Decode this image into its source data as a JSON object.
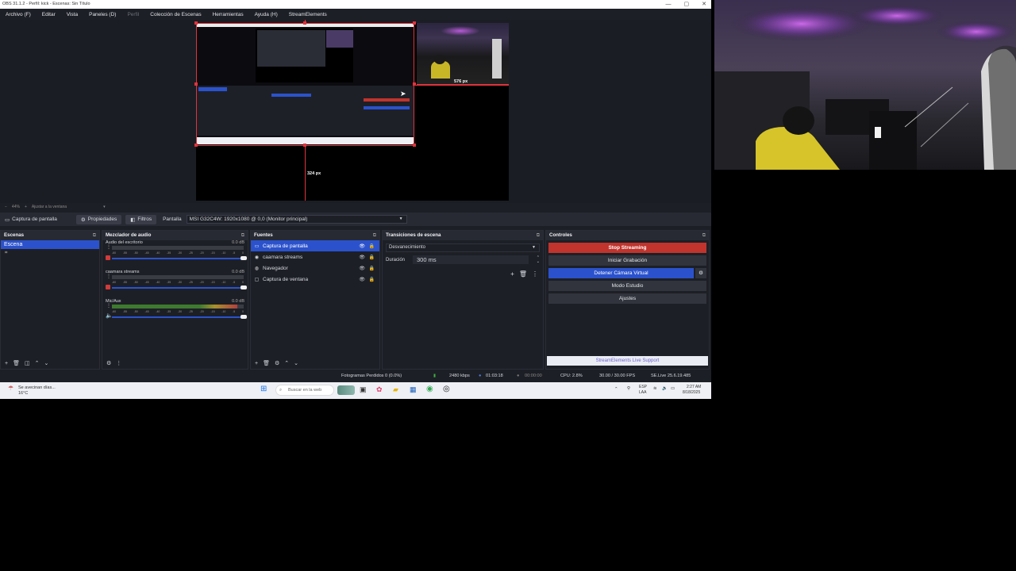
{
  "window": {
    "title": "OBS 31.1.2 - Perfil: kick - Escenas: Sin Título",
    "controls": [
      "—",
      "▢",
      "✕"
    ]
  },
  "menu": [
    {
      "label": "Archivo (F)",
      "disabled": false
    },
    {
      "label": "Editar",
      "disabled": false
    },
    {
      "label": "Vista",
      "disabled": false
    },
    {
      "label": "Paneles (D)",
      "disabled": false
    },
    {
      "label": "Perfil",
      "disabled": true
    },
    {
      "label": "Colección de Escenas",
      "disabled": false
    },
    {
      "label": "Herramientas",
      "disabled": false
    },
    {
      "label": "Ayuda (H)",
      "disabled": false
    },
    {
      "label": "StreamElements",
      "disabled": false
    }
  ],
  "preview": {
    "guide_right_label": "576 px",
    "guide_bottom_label": "324 px",
    "zoom_level": "44%",
    "zoom_mode": "Ajustar a la ventana"
  },
  "source_toolbar": {
    "source_name": "Captura de pantalla",
    "properties_label": "Propiedades",
    "filters_label": "Filtros",
    "screen_label": "Pantalla",
    "screen_value": "MSI G32C4W: 1920x1080 @ 0,0 (Monitor principal)"
  },
  "scenes": {
    "title": "Escenas",
    "items": [
      "Escena"
    ]
  },
  "mixer": {
    "title": "Mezclador de audio",
    "channels": [
      {
        "name": "Audio del escritorio",
        "db": "0.0 dB",
        "level": 0.0
      },
      {
        "name": "caamara streams",
        "db": "0.0 dB",
        "level": 0.0
      },
      {
        "name": "Mic/Aux",
        "db": "0.0 dB",
        "level": 0.95
      }
    ],
    "ticks": [
      "-60",
      "-55",
      "-50",
      "-45",
      "-40",
      "-35",
      "-30",
      "-25",
      "-20",
      "-15",
      "-10",
      "-5",
      "0"
    ]
  },
  "sources": {
    "title": "Fuentes",
    "items": [
      {
        "name": "Captura de pantalla",
        "icon": "monitor-icon",
        "active": true
      },
      {
        "name": "caamara streams",
        "icon": "camera-icon",
        "active": false
      },
      {
        "name": "Navegador",
        "icon": "globe-icon",
        "active": false
      },
      {
        "name": "Captura de ventana",
        "icon": "window-icon",
        "active": false
      }
    ]
  },
  "transitions": {
    "title": "Transiciones de escena",
    "selected": "Desvanecimiento",
    "duration_label": "Duración",
    "duration_value": "300 ms"
  },
  "controls": {
    "title": "Controles",
    "buttons": [
      "Stop Streaming",
      "Iniciar Grabación",
      "Detener Cámara Virtual",
      "Modo Estudio",
      "Ajustes"
    ],
    "support_label": "StreamElements Live Support"
  },
  "status": {
    "dropped_frames": "Fotogramas Perdidos 0 (0.0%)",
    "bitrate": "2480 kbps",
    "stream_time": "01:03:18",
    "record_time": "00:00:00",
    "cpu": "CPU: 2.8%",
    "fps": "30.00 / 30.00 FPS",
    "version": "SE.Live 25.6.19.485"
  },
  "taskbar": {
    "weather_line1": "Se avecinan días...",
    "weather_line2": "16°C",
    "search_placeholder": "Buscar en la web",
    "lang_line1": "ESP",
    "lang_line2": "LAA",
    "time": "2:27 AM",
    "date": "8/18/2025"
  }
}
